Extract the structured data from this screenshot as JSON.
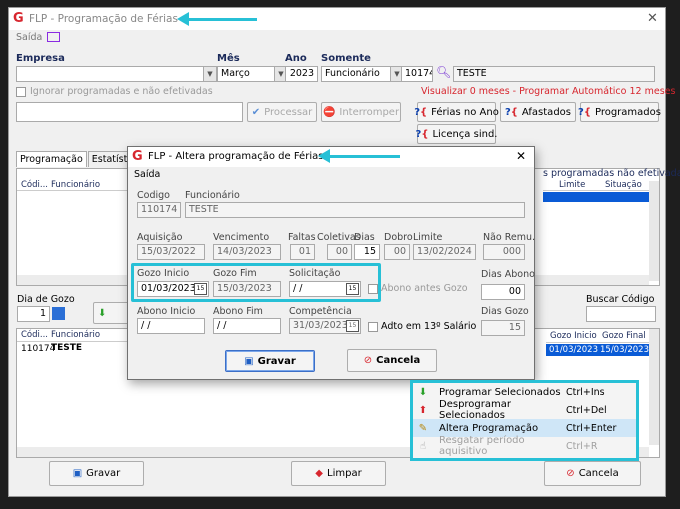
{
  "main_window": {
    "title": "FLP - Programação de Férias",
    "menu_saida": "Saída",
    "empresa_label": "Empresa",
    "mes_label": "Mês",
    "mes_value": "Março",
    "ano_label": "Ano",
    "ano_value": "2023",
    "somente_label": "Somente",
    "somente_value": "Funcionário",
    "func_code": "10174",
    "func_name": "TESTE",
    "ignorar_label": "Ignorar programadas e não efetivadas",
    "visualizar_text": "Visualizar 0 meses - Programar Automático 12 meses",
    "processar_label": "Processar",
    "interromper_label": "Interromper",
    "ferias_no_ano_label": "Férias no Ano",
    "afastados_label": "Afastados",
    "programados_label": "Programados",
    "licenca_label": "Licença sind.",
    "tabs": [
      "Programação",
      "Estatística"
    ],
    "upper_grid_cols": [
      "Códi...",
      "Funcionário"
    ],
    "upper_right_caption": "s programadas não efetivadas",
    "upper_right_cols": [
      "Limite",
      "Situação"
    ],
    "dia_de_gozo_label": "Dia de Gozo",
    "dia_de_gozo_value": "1",
    "buscar_codigo_label": "Buscar Código",
    "lower_grid_cols": [
      "Códi...",
      "Funcionário"
    ],
    "lower_row": {
      "code": "110174",
      "name": "TESTE"
    },
    "lower_right_cols": [
      "Gozo Inicio",
      "Gozo Final"
    ],
    "lower_right_row": {
      "inicio": "01/03/2023",
      "final": "15/03/2023"
    },
    "gravar_label": "Gravar",
    "limpar_label": "Limpar",
    "cancela_label": "Cancela"
  },
  "dialog": {
    "title": "FLP - Altera programação de Férias",
    "menu_saida": "Saída",
    "codigo_label": "Codigo",
    "codigo_value": "110174",
    "funcionario_label": "Funcionário",
    "funcionario_value": "TESTE",
    "aquisicao_label": "Aquisição",
    "aquisicao_value": "15/03/2022",
    "vencimento_label": "Vencimento",
    "vencimento_value": "14/03/2023",
    "faltas_label": "Faltas",
    "faltas_value": "01",
    "coletivas_label": "Coletivas",
    "coletivas_value": "00",
    "dias_label": "Dias",
    "dias_value": "15",
    "dobro_label": "Dobro",
    "dobro_value": "00",
    "limite_label": "Limite",
    "limite_value": "13/02/2024",
    "nao_remu_label": "Não Remu.",
    "nao_remu_value": "000",
    "gozo_inicio_label": "Gozo Inicio",
    "gozo_inicio_value": "01/03/2023",
    "gozo_fim_label": "Gozo Fim",
    "gozo_fim_value": "15/03/2023",
    "solicitacao_label": "Solicitação",
    "solicitacao_value": " / /",
    "abono_antes_label": "Abono antes Gozo",
    "dias_abono_label": "Dias Abono",
    "dias_abono_value": "00",
    "abono_inicio_label": "Abono Inicio",
    "abono_inicio_value": " / /",
    "abono_fim_label": "Abono Fim",
    "abono_fim_value": " / /",
    "competencia_label": "Competência",
    "competencia_value": "31/03/2023",
    "adto_label": "Adto em 13º Salário",
    "dias_gozo_label": "Dias Gozo",
    "dias_gozo_value": "15",
    "gravar_label": "Gravar",
    "cancela_label": "Cancela"
  },
  "context_menu": {
    "items": [
      {
        "label": "Programar Selecionados",
        "shortcut": "Ctrl+Ins"
      },
      {
        "label": "Desprogramar Selecionados",
        "shortcut": "Ctrl+Del"
      },
      {
        "label": "Altera Programação",
        "shortcut": "Ctrl+Enter"
      },
      {
        "label": "Resgatar período aquisitivo",
        "shortcut": "Ctrl+R"
      }
    ]
  },
  "colors": {
    "highlight": "#27c0d6",
    "brand_red": "#d7262e",
    "selection_blue": "#0a5bd6"
  }
}
